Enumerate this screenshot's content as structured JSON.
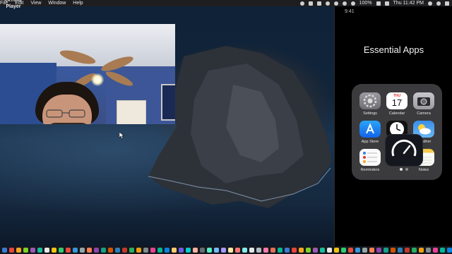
{
  "menubar": {
    "app_name": "ckTime Player",
    "menu_items": [
      "File",
      "Edit",
      "View",
      "Window",
      "Help"
    ],
    "battery": "100%",
    "datetime": "Thu 11:42 PM"
  },
  "phone": {
    "status_time": "9:41",
    "folder_title": "Essential Apps",
    "apps": [
      {
        "label": "Settings",
        "icon": "settings-icon"
      },
      {
        "label": "Calendar",
        "icon": "calendar-icon",
        "month": "THU",
        "day": "17"
      },
      {
        "label": "Camera",
        "icon": "camera-icon"
      },
      {
        "label": "App Store",
        "icon": "appstore-icon"
      },
      {
        "label": "",
        "icon": "clock-icon"
      },
      {
        "label": "Weather",
        "icon": "weather-icon"
      },
      {
        "label": "Reminders",
        "icon": "reminders-icon"
      },
      {
        "label": "",
        "icon": "speedtest-icon"
      },
      {
        "label": "Notes",
        "icon": "notes-icon"
      }
    ],
    "page_dots": 2,
    "active_page": 1
  },
  "colors": {
    "menubar": "#1e1e20",
    "folder_bg": "#3b3b3e",
    "calendar_red": "#e2382f"
  },
  "dock": {
    "colors": [
      "#3a7bd5",
      "#e7453b",
      "#f5a623",
      "#7ed321",
      "#9b59b6",
      "#1abc9c",
      "#e8e8e8",
      "#f1c40f",
      "#2ecc71",
      "#e74c3c",
      "#3498db",
      "#95a5a6",
      "#ff7f50",
      "#8e44ad",
      "#16a085",
      "#d35400",
      "#2980b9",
      "#c0392b",
      "#27ae60",
      "#f39c12",
      "#7f8c8d",
      "#e84393",
      "#00b894",
      "#0984e3",
      "#fdcb6e",
      "#6c5ce7",
      "#00cec9",
      "#fab1a0",
      "#636e72",
      "#55efc4",
      "#74b9ff",
      "#a29bfe",
      "#ffeaa7",
      "#ff7675",
      "#81ecec",
      "#dfe6e9",
      "#b2bec3",
      "#fd79a8",
      "#e17055",
      "#00b894",
      "#3a7bd5",
      "#e7453b",
      "#f5a623",
      "#7ed321",
      "#9b59b6",
      "#1abc9c",
      "#e8e8e8",
      "#f1c40f",
      "#2ecc71",
      "#e74c3c",
      "#3498db",
      "#95a5a6",
      "#ff7f50",
      "#8e44ad",
      "#16a085",
      "#d35400",
      "#2980b9",
      "#c0392b",
      "#27ae60",
      "#f39c12",
      "#7f8c8d",
      "#e84393",
      "#00b894",
      "#0984e3",
      "#fdcb6e",
      "#6c5ce7",
      "#00cec9",
      "#fab1a0"
    ]
  }
}
